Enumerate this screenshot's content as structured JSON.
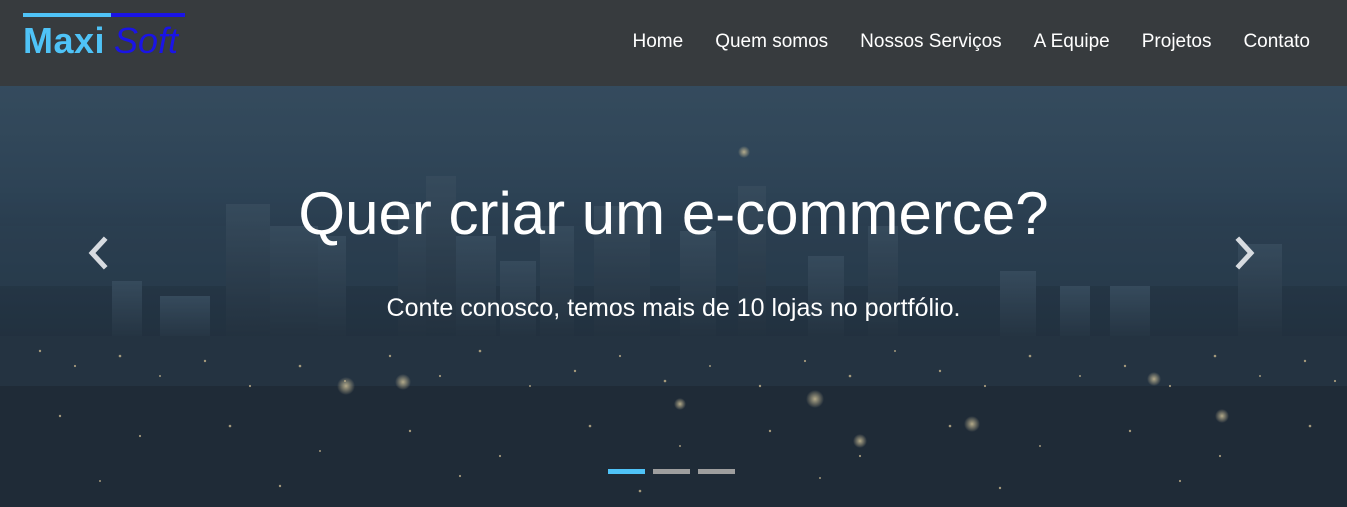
{
  "brand": {
    "part1": "Maxi",
    "part2": "Soft",
    "color_primary": "#4fc3f7",
    "color_secondary": "#1a14e6"
  },
  "nav": {
    "items": [
      {
        "label": "Home"
      },
      {
        "label": "Quem somos"
      },
      {
        "label": "Nossos Serviços"
      },
      {
        "label": "A Equipe"
      },
      {
        "label": "Projetos"
      },
      {
        "label": "Contato"
      }
    ]
  },
  "hero": {
    "title": "Quer criar um e-commerce?",
    "subtitle": "Conte conosco, temos mais de 10 lojas no portfólio.",
    "prev_icon": "chevron-left-icon",
    "next_icon": "chevron-right-icon",
    "slides_count": 3,
    "active_slide": 1
  },
  "colors": {
    "navbar_bg": "#373b3e",
    "indicator_active": "#4fc3f7",
    "indicator_inactive": "#9e9e9e"
  }
}
